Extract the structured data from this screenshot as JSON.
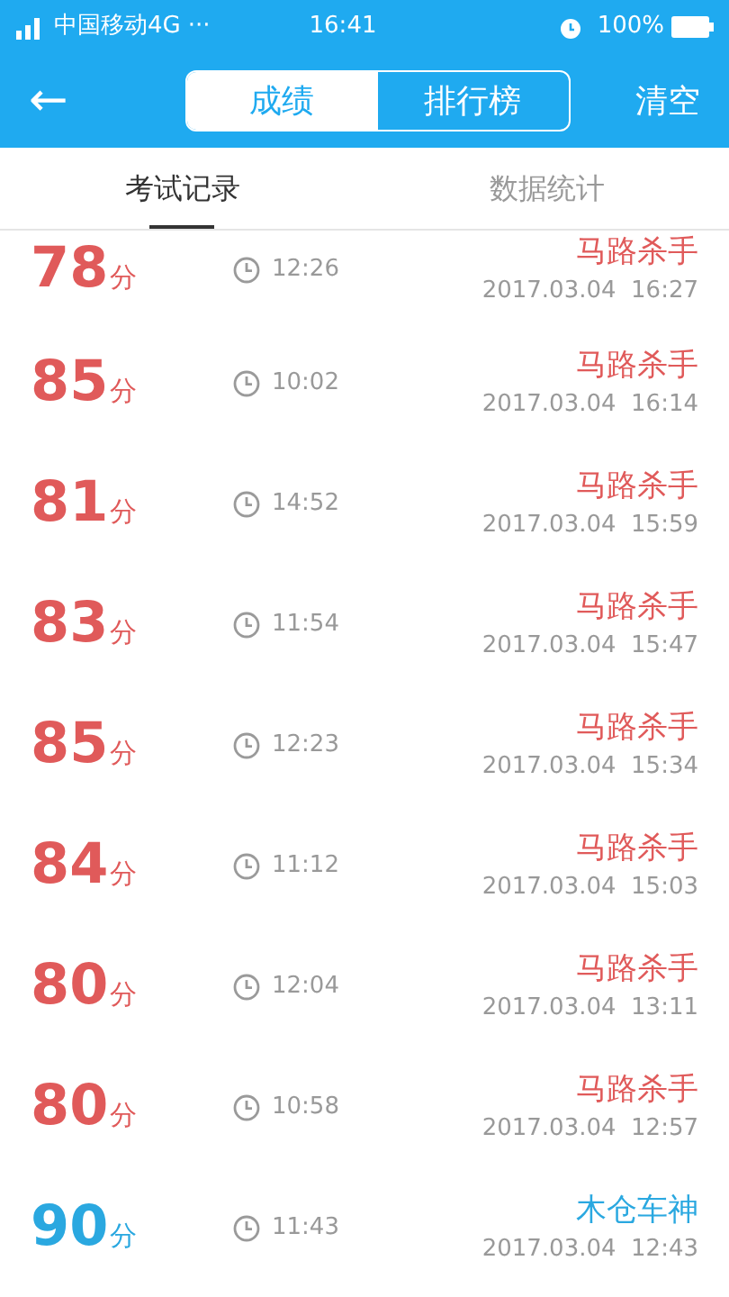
{
  "status_bar": {
    "carrier": "中国移动4G",
    "dots": "···",
    "time": "16:41",
    "battery": "100%"
  },
  "nav": {
    "back": "←",
    "segments": [
      {
        "label": "成绩",
        "selected": true
      },
      {
        "label": "排行榜",
        "selected": false
      }
    ],
    "action": "清空"
  },
  "tabs": [
    {
      "label": "考试记录",
      "selected": true
    },
    {
      "label": "数据统计",
      "selected": false
    }
  ],
  "records": [
    {
      "score": "78",
      "unit": "分",
      "duration": "12:26",
      "name": "马路杀手",
      "date": "2017.03.04  16:27",
      "color": "#e05a5a"
    },
    {
      "score": "85",
      "unit": "分",
      "duration": "10:02",
      "name": "马路杀手",
      "date": "2017.03.04  16:14",
      "color": "#e05a5a"
    },
    {
      "score": "81",
      "unit": "分",
      "duration": "14:52",
      "name": "马路杀手",
      "date": "2017.03.04  15:59",
      "color": "#e05a5a"
    },
    {
      "score": "83",
      "unit": "分",
      "duration": "11:54",
      "name": "马路杀手",
      "date": "2017.03.04  15:47",
      "color": "#e05a5a"
    },
    {
      "score": "85",
      "unit": "分",
      "duration": "12:23",
      "name": "马路杀手",
      "date": "2017.03.04  15:34",
      "color": "#e05a5a"
    },
    {
      "score": "84",
      "unit": "分",
      "duration": "11:12",
      "name": "马路杀手",
      "date": "2017.03.04  15:03",
      "color": "#e05a5a"
    },
    {
      "score": "80",
      "unit": "分",
      "duration": "12:04",
      "name": "马路杀手",
      "date": "2017.03.04  13:11",
      "color": "#e05a5a"
    },
    {
      "score": "80",
      "unit": "分",
      "duration": "10:58",
      "name": "马路杀手",
      "date": "2017.03.04  12:57",
      "color": "#e05a5a"
    },
    {
      "score": "90",
      "unit": "分",
      "duration": "11:43",
      "name": "木仓车神",
      "date": "2017.03.04  12:43",
      "color": "#2aa8e0"
    }
  ]
}
